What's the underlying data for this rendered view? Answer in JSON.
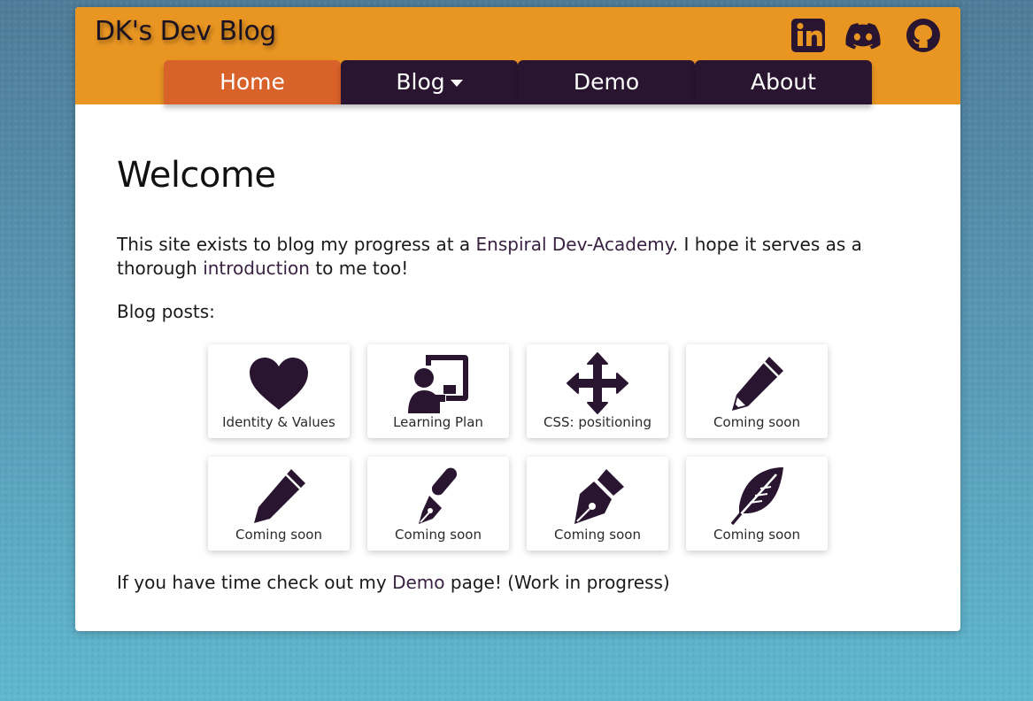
{
  "header": {
    "site_title": "DK's Dev Blog"
  },
  "social": [
    {
      "icon": "linkedin-icon"
    },
    {
      "icon": "discord-icon"
    },
    {
      "icon": "github-icon"
    }
  ],
  "nav": {
    "tabs": [
      {
        "label": "Home",
        "active": true
      },
      {
        "label": "Blog",
        "dropdown": true
      },
      {
        "label": "Demo"
      },
      {
        "label": "About"
      }
    ]
  },
  "main": {
    "heading": "Welcome",
    "intro_before": "This site exists to blog my progress at a ",
    "intro_link1": "Enspiral Dev-Academy",
    "intro_middle": ". I hope it serves as a thorough ",
    "intro_link2": "introduction",
    "intro_after": " to me too!",
    "posts_label": "Blog posts:",
    "posts": [
      {
        "label": "Identity & Values",
        "icon": "heart-icon"
      },
      {
        "label": "Learning Plan",
        "icon": "chalkboard-teacher-icon"
      },
      {
        "label": "CSS: positioning",
        "icon": "arrows-move-icon"
      },
      {
        "label": "Coming soon",
        "icon": "pencil-icon"
      },
      {
        "label": "Coming soon",
        "icon": "pencil-icon"
      },
      {
        "label": "Coming soon",
        "icon": "pen-nib-icon"
      },
      {
        "label": "Coming soon",
        "icon": "pen-fancy-icon"
      },
      {
        "label": "Coming soon",
        "icon": "feather-icon"
      }
    ],
    "outro_before": "If you have time check out my ",
    "outro_link": "Demo",
    "outro_after": " page! (Work in progress)"
  },
  "colors": {
    "header_bg": "#e89522",
    "tab_bg": "#2a1530",
    "tab_active_bg": "#d9622b",
    "icon_color": "#2a1530",
    "page_bg_top": "#4f7c99",
    "page_bg_bottom": "#5fb8cf"
  }
}
